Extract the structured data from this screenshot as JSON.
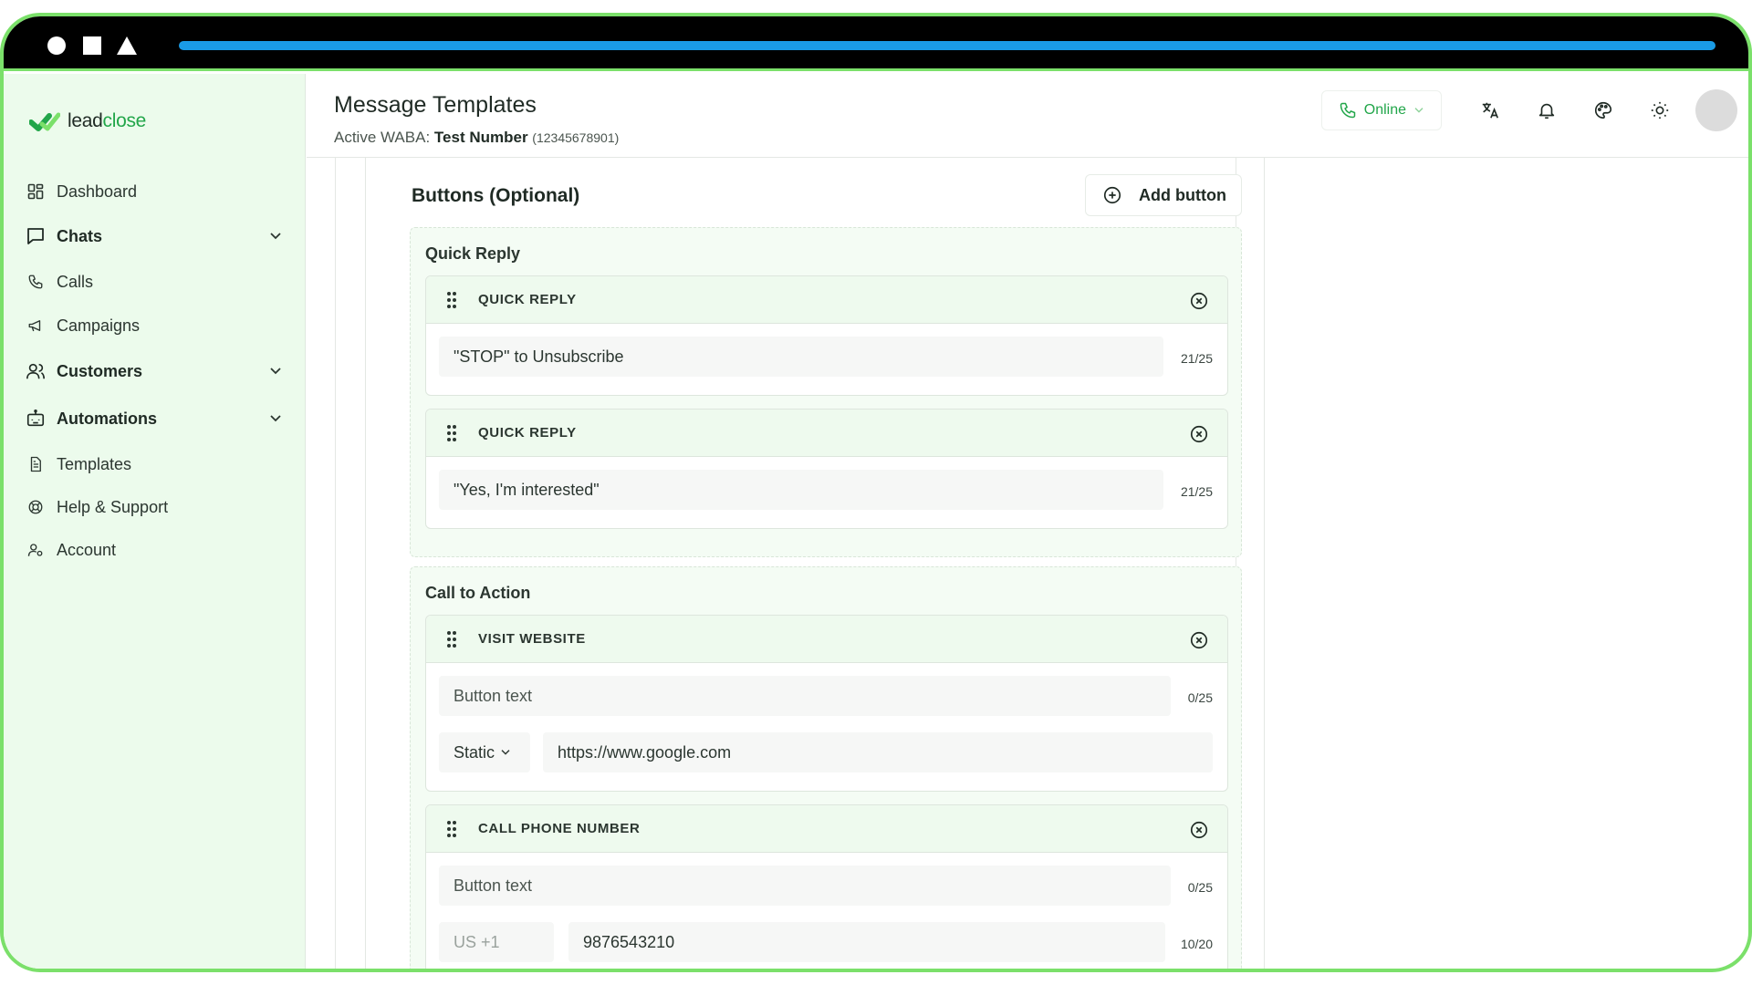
{
  "app": {
    "logo_text_a": "lead",
    "logo_text_b": "close"
  },
  "sidebar": {
    "items": [
      {
        "label": "Dashboard",
        "icon": "dashboard-icon"
      },
      {
        "label": "Chats",
        "icon": "chat-icon",
        "expandable": true
      },
      {
        "label": "Calls",
        "icon": "phone-icon"
      },
      {
        "label": "Campaigns",
        "icon": "megaphone-icon"
      },
      {
        "label": "Customers",
        "icon": "users-icon",
        "expandable": true
      },
      {
        "label": "Automations",
        "icon": "robot-icon",
        "expandable": true
      },
      {
        "label": "Templates",
        "icon": "document-icon"
      },
      {
        "label": "Help & Support",
        "icon": "lifebuoy-icon"
      },
      {
        "label": "Account",
        "icon": "user-settings-icon"
      }
    ]
  },
  "header": {
    "title": "Message Templates",
    "waba_label": "Active WABA:",
    "waba_name": "Test Number",
    "waba_number": "(12345678901)",
    "status": "Online",
    "colors": {
      "accent": "#22a64a"
    }
  },
  "main": {
    "section_title": "Buttons (Optional)",
    "add_button_label": "Add button",
    "quick_reply_group": {
      "title": "Quick Reply",
      "buttons": [
        {
          "type_label": "QUICK REPLY",
          "text": "\"STOP\" to Unsubscribe",
          "counter": "21/25"
        },
        {
          "type_label": "QUICK REPLY",
          "text": "\"Yes, I'm interested\"",
          "counter": "21/25"
        }
      ]
    },
    "cta_group": {
      "title": "Call to Action",
      "visit_website": {
        "type_label": "VISIT WEBSITE",
        "text_placeholder": "Button text",
        "counter": "0/25",
        "url_type": "Static",
        "url": "https://www.google.com"
      },
      "call_phone": {
        "type_label": "CALL PHONE NUMBER",
        "text_placeholder": "Button text",
        "counter": "0/25",
        "country_code": "US +1",
        "phone": "9876543210",
        "phone_counter": "10/20"
      }
    }
  }
}
